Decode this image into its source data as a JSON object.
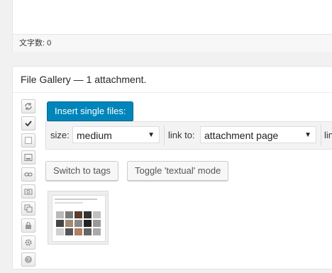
{
  "editor": {
    "word_count_label": "文字数: 0"
  },
  "gallery": {
    "title": "File Gallery — 1 attachment.",
    "insert_button": "Insert single files:",
    "size_label": "size:",
    "size_value": "medium",
    "link_label": "link to:",
    "link_value": "attachment page",
    "trailing_label": "lin",
    "switch_tags_button": "Switch to tags",
    "toggle_mode_button": "Toggle 'textual' mode",
    "toolbar_icons": [
      "refresh-icon",
      "checkbox-checked-icon",
      "checkbox-empty-icon",
      "media-insert-icon",
      "link-icon",
      "camera-icon",
      "copy-icon",
      "lock-icon",
      "gear-icon",
      "help-icon"
    ]
  },
  "colors": {
    "primary_button": "#0085ba",
    "background": "#f1f1f1"
  }
}
